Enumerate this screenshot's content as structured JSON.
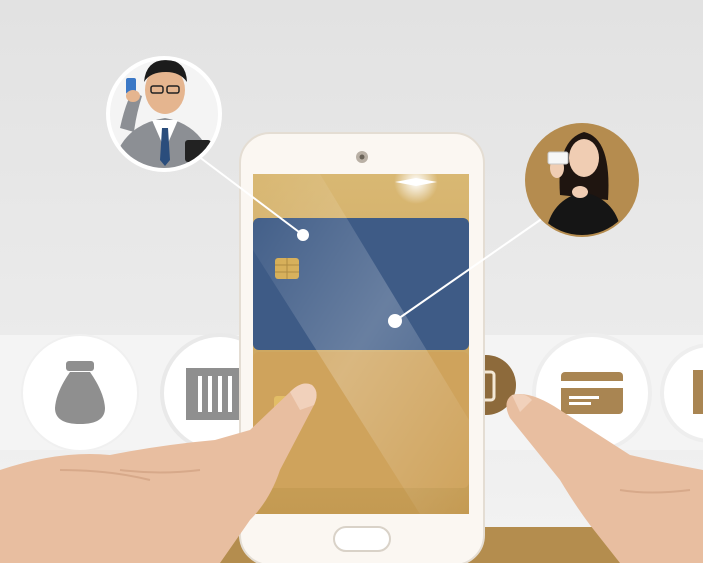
{
  "scene": {
    "description_free": true,
    "colors": {
      "background_top": "#e6e6e6",
      "background_band": "#f2f2f2",
      "gold": "#c9a25a",
      "gold_light": "#dcbd7b",
      "card_blue": "#3e5b86",
      "phone_body": "#fbf7f2",
      "icon_gray": "#8f8f8f",
      "skin": "#e9bfa0",
      "brown_accent": "#9a7a4a"
    },
    "icons": [
      "money-bag-icon",
      "receipt-icon",
      "wallet-icon",
      "credit-card-icon",
      "ticket-icon"
    ]
  }
}
